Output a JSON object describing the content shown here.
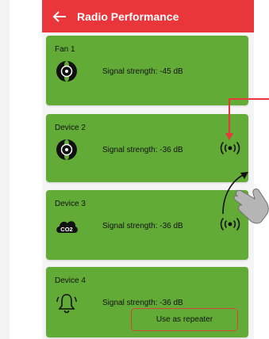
{
  "header": {
    "title": "Radio Performance",
    "back_icon": "arrow-left-icon"
  },
  "colors": {
    "header": "#e8363b",
    "card": "#63ab37",
    "annotation": "#e8363b"
  },
  "devices": [
    {
      "name": "Fan 1",
      "signal": "Signal strength: -45 dB",
      "icon": "fan-icon"
    },
    {
      "name": "Device 2",
      "signal": "Signal strength: -36 dB",
      "icon": "fan-icon",
      "radio_icon": "radio-signal-icon"
    },
    {
      "name": "Device 3",
      "signal": "Signal strength: -36 dB",
      "icon": "co2-cloud-icon",
      "icon_text": "CO2",
      "radio_icon": "radio-signal-icon"
    },
    {
      "name": "Device 4",
      "signal": "Signal strength: -36 dB",
      "icon": "bell-icon",
      "button": "Use as repeater"
    }
  ]
}
